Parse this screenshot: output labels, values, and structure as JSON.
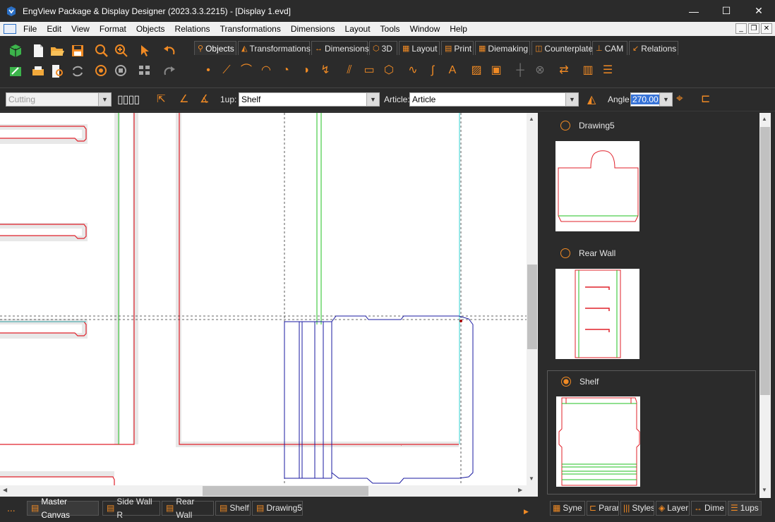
{
  "window": {
    "title": "EngView Package & Display Designer (2023.3.3.2215) - [Display 1.evd]",
    "minimize": "—",
    "maximize": "☐",
    "close": "✕"
  },
  "menu": {
    "items": [
      "File",
      "Edit",
      "View",
      "Format",
      "Objects",
      "Relations",
      "Transformations",
      "Dimensions",
      "Layout",
      "Tools",
      "Window",
      "Help"
    ]
  },
  "ribbon": {
    "tabs": [
      {
        "label": "Objects",
        "icon": "objects-icon"
      },
      {
        "label": "Transformations",
        "icon": "transformations-icon"
      },
      {
        "label": "Dimensions",
        "icon": "dimensions-icon"
      },
      {
        "label": "3D",
        "icon": "3d-icon"
      },
      {
        "label": "Layout",
        "icon": "layout-icon"
      },
      {
        "label": "Print",
        "icon": "print-icon"
      },
      {
        "label": "Diemaking",
        "icon": "diemaking-icon"
      },
      {
        "label": "Counterplate",
        "icon": "counterplate-icon"
      },
      {
        "label": "CAM",
        "icon": "cam-icon"
      },
      {
        "label": "Relations",
        "icon": "relations-icon"
      }
    ],
    "active_tab": "Objects"
  },
  "toolbar2": {
    "cutting_value": "Cutting",
    "oneup_label": "1up:",
    "oneup_value": "Shelf",
    "article_label": "Article:",
    "article_value": "Article",
    "angle_label": "Angle",
    "angle_value": "270.00"
  },
  "thumbnails": [
    {
      "name": "Drawing5",
      "selected": false
    },
    {
      "name": "Rear Wall",
      "selected": false
    },
    {
      "name": "Shelf",
      "selected": true
    }
  ],
  "bottom_tabs": [
    {
      "label": "Master Canvas",
      "active": true
    },
    {
      "label": "Side Wall R",
      "active": false
    },
    {
      "label": "Rear Wall",
      "active": false
    },
    {
      "label": "Shelf",
      "active": false
    },
    {
      "label": "Drawing5",
      "active": false
    }
  ],
  "bottom_more": "...",
  "right_tabs": [
    {
      "label": "Syne"
    },
    {
      "label": "Parar"
    },
    {
      "label": "Styles"
    },
    {
      "label": "Layer"
    },
    {
      "label": "Dime"
    },
    {
      "label": "1ups"
    }
  ],
  "colors": {
    "accent": "#f08a24",
    "cut_line": "#e0202a",
    "crease_line": "#22c022",
    "selection": "#1a1aa0"
  }
}
